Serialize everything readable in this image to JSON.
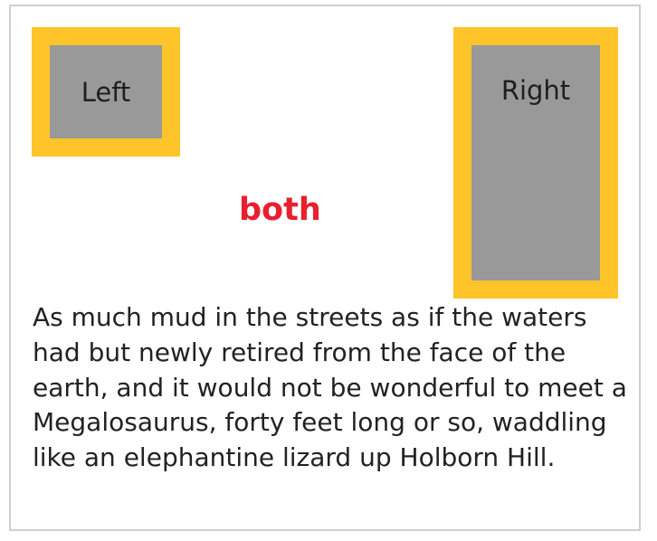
{
  "boxes": {
    "left_label": "Left",
    "right_label": "Right"
  },
  "clear_label": "both",
  "paragraph": "As much mud in the streets as if the waters had but newly retired from the face of the earth, and it would not be wonderful to meet a Megalosaurus, forty feet long or so, waddling like an elephantine lizard up Holborn Hill.",
  "colors": {
    "border_accent": "#ffc42a",
    "box_fill": "#999999",
    "clear_label": "#e8202e"
  }
}
